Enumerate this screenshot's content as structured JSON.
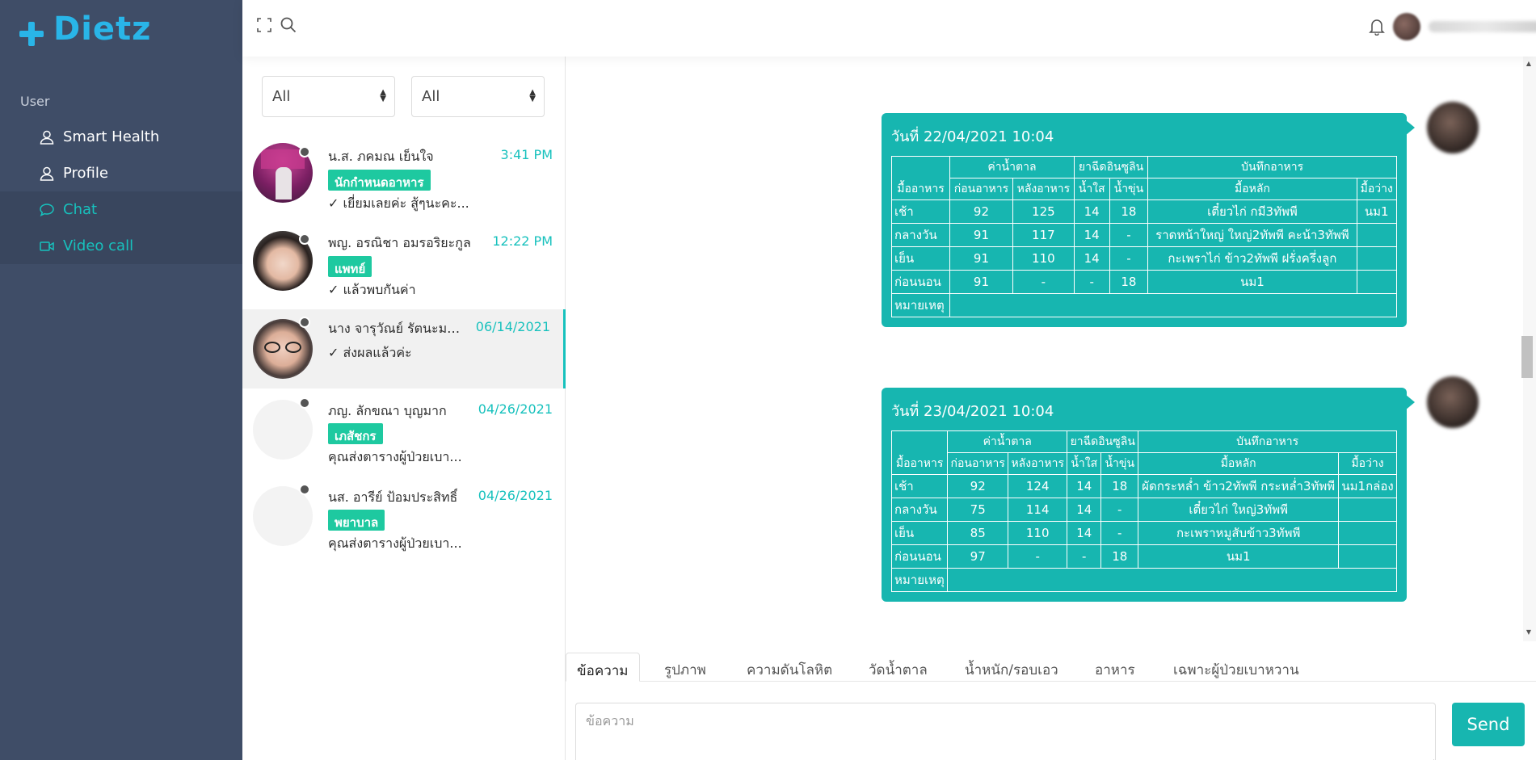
{
  "brand": {
    "name": "Dietz",
    "color": "#29b5e8"
  },
  "sidebar": {
    "caption": "User",
    "items": [
      {
        "label": "Smart Health",
        "icon": "user-icon"
      },
      {
        "label": "Profile",
        "icon": "user-icon"
      },
      {
        "label": "Chat",
        "icon": "chat-bubble-icon",
        "active": true
      },
      {
        "label": "Video call",
        "icon": "video-camera-icon",
        "active": true
      }
    ]
  },
  "header": {
    "icons": [
      "fullscreen-icon",
      "search-icon",
      "bell-icon"
    ],
    "user_name": ""
  },
  "filters": {
    "filter1": "All",
    "filter2": "All"
  },
  "contacts": [
    {
      "name": "น.ส. ภคมณ เย็นใจ",
      "time": "3:41 PM",
      "role": "นักกำหนดอาหาร",
      "message": "✓ เยี่ยมเลยค่ะ สู้ๆนะคะ..."
    },
    {
      "name": "พญ. อรณิชา อมรอริยะกูล",
      "time": "12:22 PM",
      "role": "แพทย์",
      "message": "✓ แล้วพบกันค่า"
    },
    {
      "name": "นาง จารุวัณย์ รัตนะมงค...",
      "time": "06/14/2021",
      "role": "",
      "message": "✓ ส่งผลแล้วค่ะ",
      "active": true
    },
    {
      "name": "ภญ. ลักขณา บุญมาก",
      "time": "04/26/2021",
      "role": "เภสัชกร",
      "message": "คุณส่งตารางผู้ป่วยเบา..."
    },
    {
      "name": "นส. อารีย์ ป้อมประสิทธิ์",
      "time": "04/26/2021",
      "role": "พยาบาล",
      "message": "คุณส่งตารางผู้ป่วยเบา..."
    }
  ],
  "table_headers": {
    "meal": "มื้ออาหาร",
    "sugar": "ค่าน้ำตาล",
    "insulin": "ยาฉีดอินซูลิน",
    "food_log": "บันทึกอาหาร",
    "before_meal": "ก่อนอาหาร",
    "after_meal": "หลังอาหาร",
    "clear": "น้ำใส",
    "cloudy": "น้ำขุ่น",
    "main_meal": "มื้อหลัก",
    "snack": "มื้อว่าง",
    "note": "หมายเหตุ"
  },
  "messages": [
    {
      "date": "วันที่ 22/04/2021 10:04",
      "rows": [
        {
          "meal": "เช้า",
          "before": "92",
          "after": "125",
          "clear": "14",
          "cloudy": "18",
          "main": "เตี๋ยวไก่ กมี3ทัพพี",
          "snack": "นม1"
        },
        {
          "meal": "กลางวัน",
          "before": "91",
          "after": "117",
          "clear": "14",
          "cloudy": "-",
          "main": "ราดหน้าใหญ่ ใหญ่2ทัพพี คะน้า3ทัพพี",
          "snack": ""
        },
        {
          "meal": "เย็น",
          "before": "91",
          "after": "110",
          "clear": "14",
          "cloudy": "-",
          "main": "กะเพราไก่ ข้าว2ทัพพี ฝรั่งครึ่งลูก",
          "snack": ""
        },
        {
          "meal": "ก่อนนอน",
          "before": "91",
          "after": "-",
          "clear": "-",
          "cloudy": "18",
          "main": "นม1",
          "snack": ""
        }
      ],
      "note": ""
    },
    {
      "date": "วันที่ 23/04/2021 10:04",
      "rows": [
        {
          "meal": "เช้า",
          "before": "92",
          "after": "124",
          "clear": "14",
          "cloudy": "18",
          "main": "ผัดกระหล่ำ ข้าว2ทัพพี กระหล่ำ3ทัพพี",
          "snack": "นม1กล่อง"
        },
        {
          "meal": "กลางวัน",
          "before": "75",
          "after": "114",
          "clear": "14",
          "cloudy": "-",
          "main": "เตี๋ยวไก่ ใหญ่3ทัพพี",
          "snack": ""
        },
        {
          "meal": "เย็น",
          "before": "85",
          "after": "110",
          "clear": "14",
          "cloudy": "-",
          "main": "กะเพราหมูสับข้าว3ทัพพี",
          "snack": ""
        },
        {
          "meal": "ก่อนนอน",
          "before": "97",
          "after": "-",
          "clear": "-",
          "cloudy": "18",
          "main": "นม1",
          "snack": ""
        }
      ],
      "note": ""
    }
  ],
  "composer": {
    "tabs": [
      "ข้อความ",
      "รูปภาพ",
      "ความดันโลหิต",
      "วัดน้ำตาล",
      "น้ำหนัก/รอบเอว",
      "อาหาร",
      "เฉพาะผู้ป่วยเบาหวาน"
    ],
    "placeholder": "ข้อความ",
    "send_label": "Send"
  },
  "colors": {
    "sidebar": "#3f4d67",
    "accent": "#17b6b0",
    "role_badge": "#1ec9a0"
  }
}
